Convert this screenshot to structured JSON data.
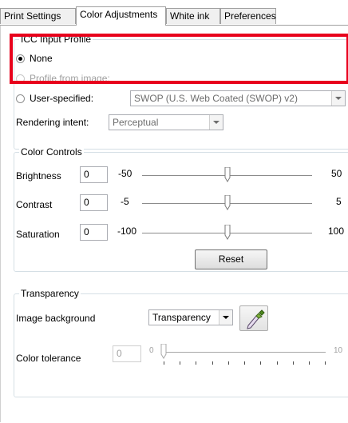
{
  "tabs": [
    {
      "label": "Print Settings"
    },
    {
      "label": "Color Adjustments"
    },
    {
      "label": "White ink"
    },
    {
      "label": "Preferences"
    }
  ],
  "icc_profile": {
    "legend": "ICC Input Profile",
    "none_label": "None",
    "from_image_label": "Profile from image:",
    "user_specified_label": "User-specified:",
    "user_specified_value": "SWOP (U.S. Web Coated (SWOP) v2)",
    "rendering_intent_label": "Rendering intent:",
    "rendering_intent_value": "Perceptual"
  },
  "color_controls": {
    "legend": "Color Controls",
    "brightness": {
      "label": "Brightness",
      "value": "0",
      "min": "-50",
      "max": "50",
      "level": 0.5
    },
    "contrast": {
      "label": "Contrast",
      "value": "0",
      "min": "-5",
      "max": "5",
      "level": 0.5
    },
    "saturation": {
      "label": "Saturation",
      "value": "0",
      "min": "-100",
      "max": "100",
      "level": 0.5
    },
    "reset_label": "Reset"
  },
  "transparency": {
    "legend": "Transparency",
    "image_background_label": "Image background",
    "image_background_value": "Transparency",
    "color_tolerance_label": "Color tolerance",
    "color_tolerance_value": "0",
    "tolerance_min": "0",
    "tolerance_max": "10",
    "tolerance_level": 0
  },
  "colors": {
    "highlight": "#e8001c",
    "group_border": "#d5dfe5"
  },
  "icons": {
    "eyedropper": "eyedropper-icon"
  }
}
